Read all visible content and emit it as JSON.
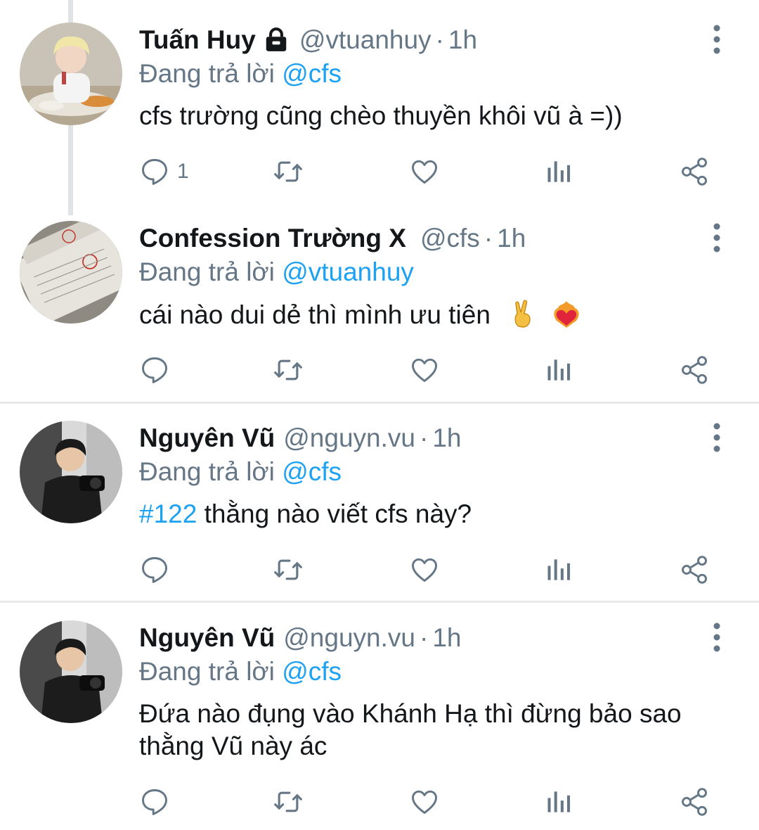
{
  "tweets": [
    {
      "name": "Tuấn Huy",
      "handle": "@vtuanhuy",
      "separator": "·",
      "time": "1h",
      "replying_prefix": "Đang trả lời ",
      "replying_to": "@cfs",
      "text": "cfs trường cũng chèo thuyền khôi vũ à =))",
      "protected_icon": "lock-icon",
      "reply_count": "1"
    },
    {
      "name": "Confession Trường X",
      "handle": "@cfs",
      "separator": "·",
      "time": "1h",
      "replying_prefix": "Đang trả lời ",
      "replying_to": "@vtuanhuy",
      "text": "cái nào dui dẻ thì mình ưu tiên",
      "emojis": [
        "crossed-fingers-emoji",
        "heart-on-fire-emoji"
      ],
      "reply_count": ""
    },
    {
      "name": "Nguyên Vũ",
      "handle": "@nguyn.vu",
      "separator": "·",
      "time": "1h",
      "replying_prefix": "Đang trả lời ",
      "replying_to": "@cfs",
      "hashtag": "#122",
      "text": " thằng nào viết cfs này?",
      "reply_count": ""
    },
    {
      "name": "Nguyên Vũ",
      "handle": "@nguyn.vu",
      "separator": "·",
      "time": "1h",
      "replying_prefix": "Đang trả lời ",
      "replying_to": "@cfs",
      "text": "Đứa nào đụng vào Khánh Hạ thì đừng bảo sao thằng Vũ này ác",
      "reply_count": ""
    }
  ],
  "icons": [
    "reply-icon",
    "retweet-icon",
    "like-icon",
    "analytics-icon",
    "share-icon",
    "more-options-icon"
  ],
  "colors": {
    "accent": "#1da1f2",
    "secondary_text": "#657786",
    "icon": "#657786",
    "divider": "#e6e8ea"
  }
}
